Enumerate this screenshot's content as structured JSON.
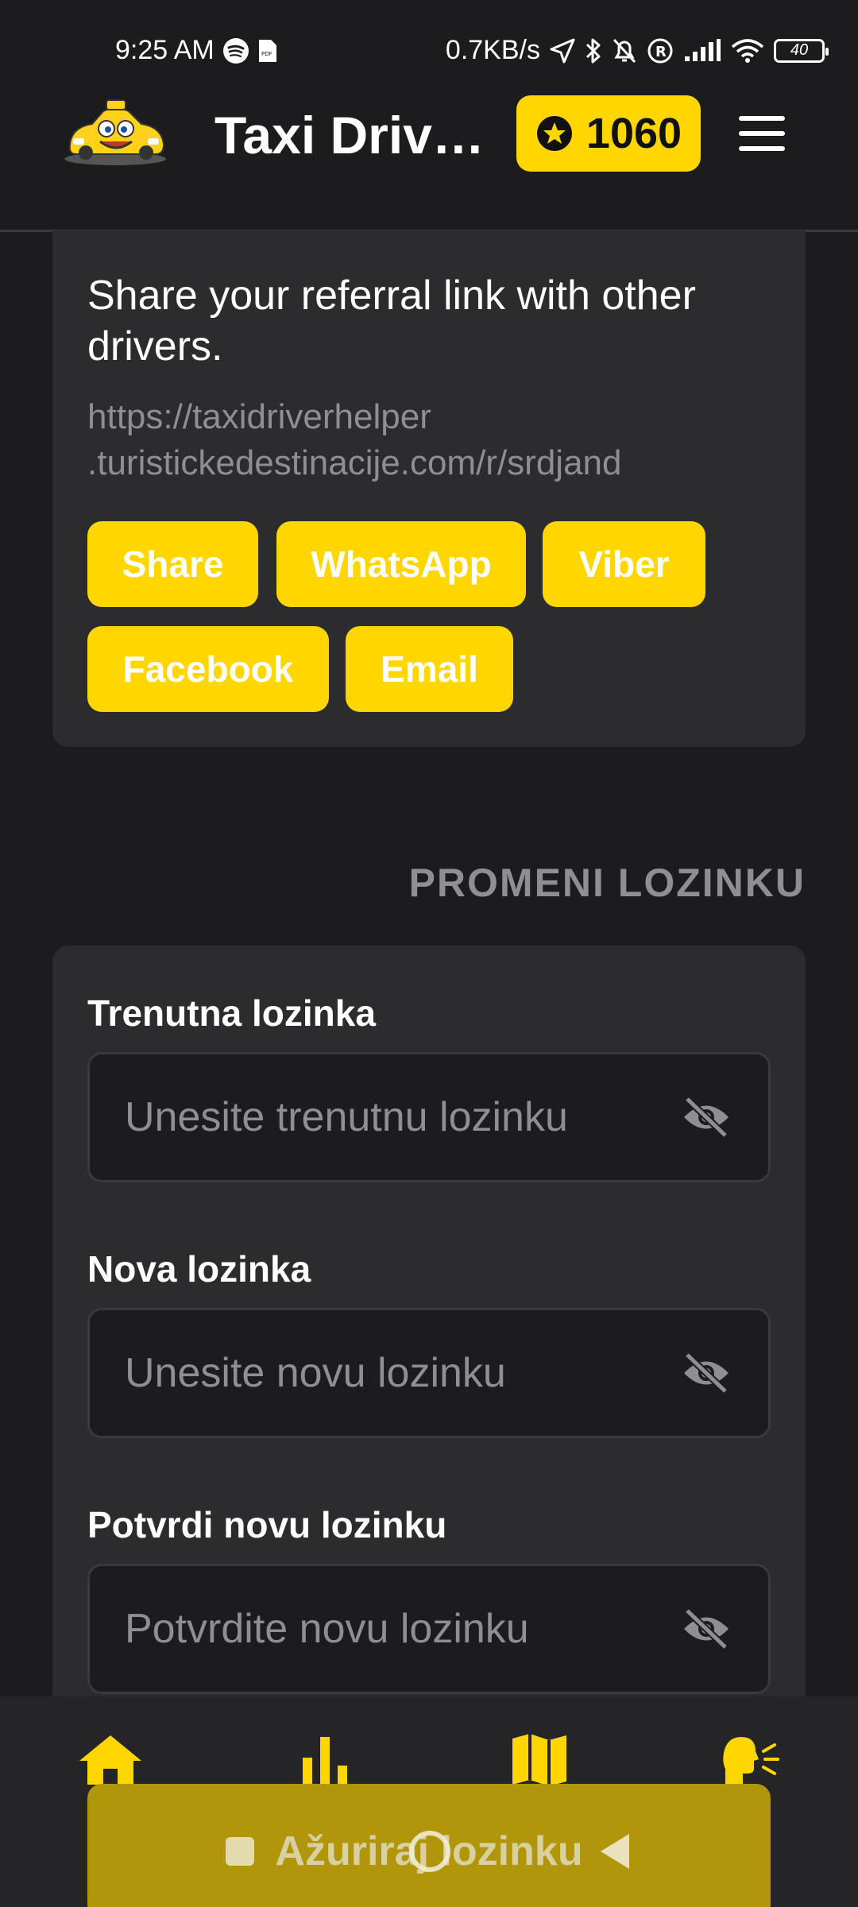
{
  "status_bar": {
    "time": "9:25 AM",
    "net_speed": "0.7KB/s",
    "battery": "40",
    "icons": [
      "spotify-icon",
      "pdf-icon",
      "location-arrow-icon",
      "bluetooth-icon",
      "bell-off-icon",
      "registered-icon",
      "signal-icon",
      "wifi-icon",
      "battery-icon"
    ]
  },
  "header": {
    "title": "Taxi Driver Helper",
    "points": "1060",
    "logo_icon": "taxi-logo-icon",
    "menu_icon": "hamburger-menu-icon",
    "star_icon": "star-circle-icon"
  },
  "referral": {
    "text": "Share your referral link with other drivers.",
    "link_line1": "https://taxidriverhelper",
    "link_line2": ".turistickedestinacije.com/r/srdjand",
    "buttons": {
      "share": "Share",
      "whatsapp": "WhatsApp",
      "viber": "Viber",
      "facebook": "Facebook",
      "email": "Email"
    }
  },
  "change_password": {
    "section_title": "PROMENI LOZINKU",
    "current": {
      "label": "Trenutna lozinka",
      "placeholder": "Unesite trenutnu lozinku"
    },
    "new": {
      "label": "Nova lozinka",
      "placeholder": "Unesite novu lozinku"
    },
    "confirm": {
      "label": "Potvrdi novu lozinku",
      "placeholder": "Potvrdite novu lozinku"
    },
    "submit_label": "Ažuriraj lozinku"
  },
  "bottom_nav": {
    "items": [
      "home-icon",
      "stats-icon",
      "map-icon",
      "voice-icon"
    ]
  },
  "colors": {
    "accent": "#ffd600",
    "background": "#1c1c1e",
    "card": "#2c2c2e",
    "muted": "#8e8e93"
  }
}
